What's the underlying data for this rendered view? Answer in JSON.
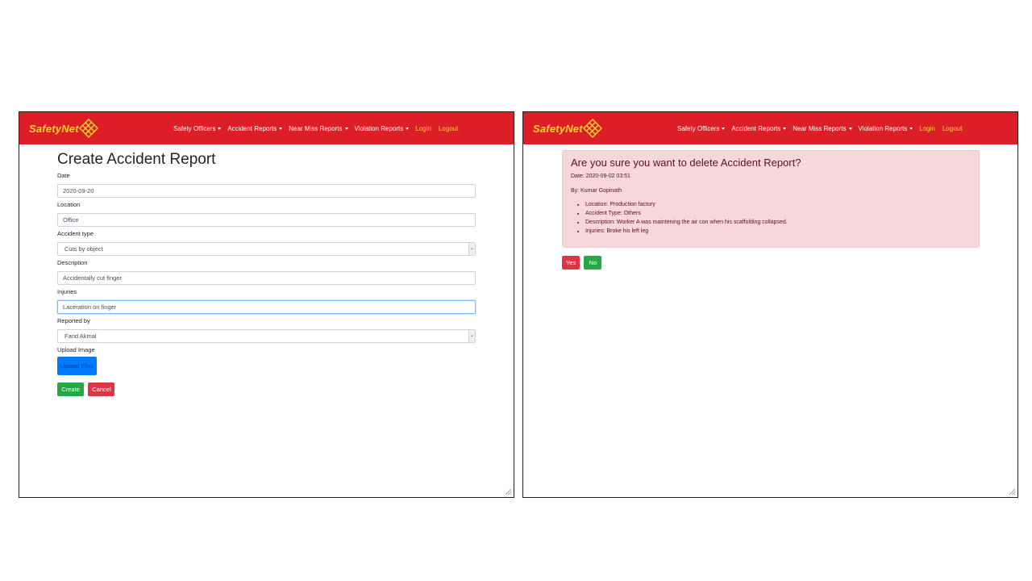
{
  "brand": {
    "name": "SafetyNet"
  },
  "nav": {
    "items": [
      {
        "label": "Safety Officers"
      },
      {
        "label": "Accident Reports"
      },
      {
        "label": "Near Miss Reports"
      },
      {
        "label": "Violation Reports"
      }
    ],
    "login": "Login",
    "logout": "Logout"
  },
  "create_form": {
    "title": "Create Accident Report",
    "date_label": "Date",
    "date_value": "2020-09-20",
    "location_label": "Location",
    "location_value": "Office",
    "type_label": "Accident type",
    "type_value": "Cuts by object",
    "description_label": "Description",
    "description_value": "Accidentally cut finger",
    "injuries_label": "Injuries",
    "injuries_value": "Laceration on finger",
    "reported_label": "Reported by",
    "reported_value": "Farid Akmal",
    "upload_label": "Upload Image",
    "upload_button": "Upload Files",
    "create_button": "Create",
    "cancel_button": "Cancel"
  },
  "delete_confirm": {
    "title": "Are you sure you want to delete Accident Report?",
    "date": "Date: 2020-09-02 03:51",
    "by": "By: Kumar Gopinath",
    "details": [
      "Location: Production factory",
      "Accident Type: Others",
      "Description: Worker A was maintening the air con when his scaffolding collapsed.",
      "Injuries: Broke his left leg"
    ],
    "yes_button": "Yes",
    "no_button": "No"
  },
  "colors": {
    "navbar": "#dc1f26",
    "brand": "#f7d430",
    "primary": "#007bff",
    "success": "#28a745",
    "danger": "#dc3545",
    "alert_bg": "#f8d7da"
  }
}
